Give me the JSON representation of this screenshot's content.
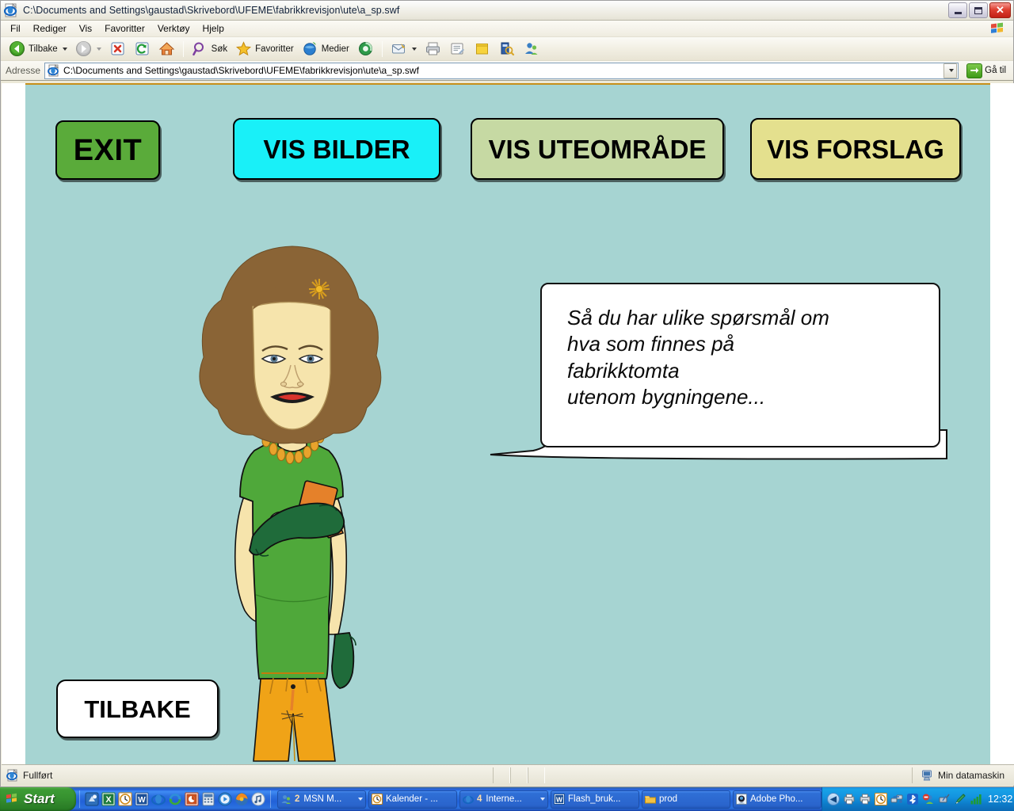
{
  "window": {
    "title": "C:\\Documents and Settings\\gaustad\\Skrivebord\\UFEME\\fabrikkrevisjon\\ute\\a_sp.swf",
    "icons": {
      "app": "ie-document-icon",
      "minimize": "minimize-icon",
      "maximize": "maximize-icon",
      "close": "close-icon"
    }
  },
  "menu": {
    "items": [
      {
        "label": "Fil"
      },
      {
        "label": "Rediger"
      },
      {
        "label": "Vis"
      },
      {
        "label": "Favoritter"
      },
      {
        "label": "Verktøy"
      },
      {
        "label": "Hjelp"
      }
    ],
    "brand_icon": "windows-flag-icon"
  },
  "toolbar": {
    "back_label": "Tilbake",
    "back_icon": "back-arrow-icon",
    "back_dropdown_icon": "chevron-down-icon",
    "forward_icon": "forward-arrow-icon",
    "forward_dropdown_icon": "chevron-down-icon",
    "stop_icon": "stop-icon",
    "refresh_icon": "refresh-icon",
    "home_icon": "home-icon",
    "search_label": "Søk",
    "search_icon": "search-icon",
    "favorites_label": "Favoritter",
    "favorites_icon": "star-icon",
    "media_label": "Medier",
    "media_icon": "media-icon",
    "history_icon": "history-icon",
    "mail_icon": "mail-icon",
    "mail_dropdown_icon": "chevron-down-icon",
    "print_icon": "print-icon",
    "edit_icon": "edit-icon",
    "discuss_icon": "notes-icon",
    "research_icon": "research-icon",
    "messenger_icon": "messenger-icon"
  },
  "address": {
    "label": "Adresse",
    "value": "C:\\Documents and Settings\\gaustad\\Skrivebord\\UFEME\\fabrikkrevisjon\\ute\\a_sp.swf",
    "placeholder": "",
    "doc_icon": "document-icon",
    "dropdown_icon": "chevron-down-icon",
    "go_label": "Gå til",
    "go_icon": "go-arrow-icon"
  },
  "stage": {
    "background_color": "#a6d4d2",
    "top_rule_color": "#c78f1a",
    "buttons": [
      {
        "id": "exit",
        "label": "EXIT",
        "color": "#5aab3a"
      },
      {
        "id": "bilder",
        "label": "VIS BILDER",
        "color": "#19f0f8"
      },
      {
        "id": "ute",
        "label": "VIS UTEOMRÅDE",
        "color": "#c6d9a3"
      },
      {
        "id": "forslag",
        "label": "VIS FORSLAG",
        "color": "#e4e08e"
      }
    ],
    "back_button": {
      "id": "tilbake",
      "label": "TILBAKE",
      "color": "#ffffff"
    },
    "speech_bubble": {
      "text": "Så du har ulike spørsmål om\nhva som finnes på\nfabrikktomta\nutenom bygningene...",
      "background_color": "#ffffff",
      "border_color": "#111111"
    },
    "character": {
      "name": "woman-character-illustration",
      "hair_color": "#8a6436",
      "skin_color": "#f6e4ac",
      "shirt_color": "#4fa83a",
      "pants_color": "#f0a317",
      "glove_color": "#1f6b3a",
      "tool_color": "#e5812a",
      "necklace_color": "#e8a32c",
      "flower_color": "#f0b829"
    }
  },
  "statusbar": {
    "text": "Fullført",
    "icon": "ie-document-icon",
    "zone_label": "Min datamaskin",
    "zone_icon": "my-computer-icon"
  },
  "taskbar": {
    "start_label": "Start",
    "start_icon": "windows-flag-icon",
    "quicklaunch": [
      {
        "name": "show-desktop-icon"
      },
      {
        "name": "excel-icon"
      },
      {
        "name": "clock-icon"
      },
      {
        "name": "word-icon"
      },
      {
        "name": "internet-explorer-icon"
      },
      {
        "name": "sync-icon"
      },
      {
        "name": "powerpoint-icon"
      },
      {
        "name": "calculator-icon"
      },
      {
        "name": "media-player-icon"
      },
      {
        "name": "firefox-icon"
      },
      {
        "name": "itunes-icon"
      }
    ],
    "tasks": [
      {
        "icon": "messenger-icon",
        "count": "2",
        "label": "MSN M...",
        "has_dropdown": true
      },
      {
        "icon": "clock-icon",
        "count": "",
        "label": "Kalender - ...",
        "has_dropdown": false
      },
      {
        "icon": "internet-explorer-icon",
        "count": "4",
        "label": "Interne...",
        "has_dropdown": true
      },
      {
        "icon": "word-icon",
        "count": "",
        "label": "Flash_bruk...",
        "has_dropdown": false
      },
      {
        "icon": "folder-icon",
        "count": "",
        "label": "prod",
        "has_dropdown": false
      },
      {
        "icon": "photoshop-icon",
        "count": "",
        "label": "Adobe Pho...",
        "has_dropdown": false
      }
    ],
    "tray": {
      "expand_icon": "chevron-left-icon",
      "icons": [
        {
          "name": "network-printer-icon"
        },
        {
          "name": "network-printer-icon"
        },
        {
          "name": "clock-tray-icon"
        },
        {
          "name": "network-connection-icon"
        },
        {
          "name": "bluetooth-icon"
        },
        {
          "name": "user-blocked-icon"
        },
        {
          "name": "wireless-icon"
        },
        {
          "name": "pen-icon"
        },
        {
          "name": "signal-bars-icon"
        }
      ],
      "clock": "12:32"
    }
  }
}
